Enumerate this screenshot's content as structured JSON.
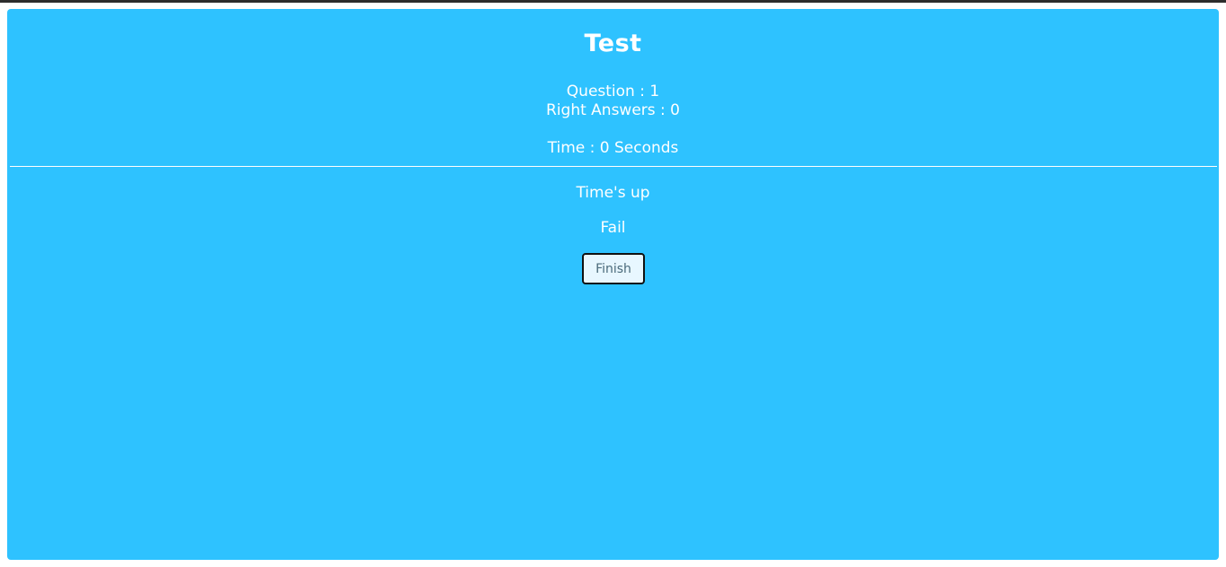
{
  "quiz": {
    "title": "Test",
    "question_line": "Question : 1",
    "right_answers_line": "Right Answers : 0",
    "time_line": "Time : 0 Seconds",
    "status_message": "Time's up",
    "result": "Fail",
    "finish_label": "Finish"
  },
  "colors": {
    "panel_background": "#2ec2ff",
    "text": "#ffffff",
    "button_background": "#e8f7ff",
    "button_border": "#111111"
  }
}
